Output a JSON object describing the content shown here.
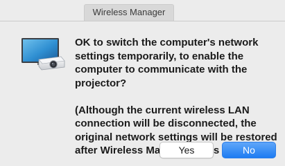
{
  "window": {
    "title": "Wireless Manager"
  },
  "dialog": {
    "icon": "projector-with-screen-icon",
    "message_line1": "OK to switch the computer's network settings temporarily, to enable the computer to communicate with the projector?",
    "message_line2": "(Although the current wireless LAN connection will be disconnected, the original network settings will be restored after Wireless Manager shuts down.)"
  },
  "buttons": {
    "yes_label": "Yes",
    "no_label": "No"
  },
  "colors": {
    "background": "#ececec",
    "accent": "#1d7cf2"
  }
}
